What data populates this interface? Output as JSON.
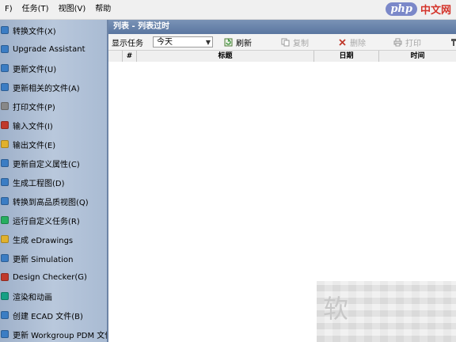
{
  "menubar": {
    "items": [
      "F)",
      "任务(T)",
      "视图(V)",
      "帮助"
    ]
  },
  "logo": {
    "php": "php",
    "cn": "中文网"
  },
  "sidebar": {
    "tasks": [
      {
        "label": "转换文件(X)",
        "icon_color": "#3b7dc4"
      },
      {
        "label": "Upgrade Assistant",
        "icon_color": "#3b7dc4"
      },
      {
        "label": "更新文件(U)",
        "icon_color": "#3b7dc4"
      },
      {
        "label": "更新相关的文件(A)",
        "icon_color": "#3b7dc4"
      },
      {
        "label": "打印文件(P)",
        "icon_color": "#888888"
      },
      {
        "label": "输入文件(I)",
        "icon_color": "#c0392b"
      },
      {
        "label": "输出文件(E)",
        "icon_color": "#e1b12c"
      },
      {
        "label": "更新自定义属性(C)",
        "icon_color": "#3b7dc4"
      },
      {
        "label": "生成工程图(D)",
        "icon_color": "#3b7dc4"
      },
      {
        "label": "转换到高品质视图(Q)",
        "icon_color": "#3b7dc4"
      },
      {
        "label": "运行自定义任务(R)",
        "icon_color": "#27ae60"
      },
      {
        "label": "生成 eDrawings",
        "icon_color": "#e1b12c"
      },
      {
        "label": "更新 Simulation",
        "icon_color": "#3b7dc4"
      },
      {
        "label": "Design Checker(G)",
        "icon_color": "#c0392b"
      },
      {
        "label": "渲染和动画",
        "icon_color": "#16a085"
      },
      {
        "label": "创建 ECAD 文件(B)",
        "icon_color": "#3b7dc4"
      },
      {
        "label": "更新 Workgroup PDM 文件",
        "icon_color": "#3b7dc4"
      }
    ]
  },
  "main": {
    "header": "列表 - 列表过时",
    "toolbar": {
      "show_label": "显示任务",
      "combo_value": "今天",
      "refresh": "刷新",
      "copy": "复制",
      "delete": "删除",
      "print": "打印"
    },
    "columns": {
      "num": "#",
      "title": "标题",
      "date": "日期",
      "time": "时间"
    }
  },
  "watermark": {
    "glyph": "软"
  },
  "colors": {
    "sidebar_bg": "#b9c8dc",
    "header_bg": "#5a76a0",
    "delete_icon": "#c0392b"
  }
}
